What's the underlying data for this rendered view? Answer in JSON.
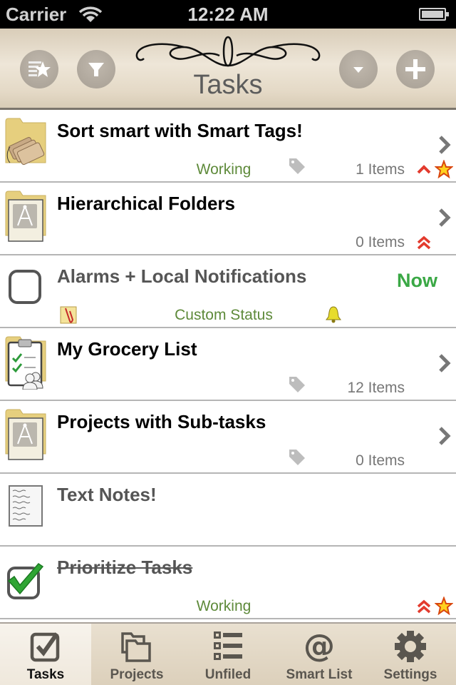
{
  "status_bar": {
    "carrier": "Carrier",
    "time": "12:22 AM",
    "wifi_icon": "wifi-icon",
    "battery_icon": "battery-full-icon"
  },
  "nav": {
    "title": "Tasks",
    "buttons": [
      {
        "name": "smart-tags-button",
        "icon": "list-star-icon"
      },
      {
        "name": "filter-button",
        "icon": "funnel-icon"
      },
      {
        "name": "sort-button",
        "icon": "chevron-down-icon"
      },
      {
        "name": "add-button",
        "icon": "plus-icon"
      }
    ]
  },
  "colors": {
    "status_green": "#5e8a3a",
    "now_green": "#3aa845",
    "priority_red": "#e33b2e",
    "star_yellow": "#ffd21f",
    "nav_bg": "#e4d9c6"
  },
  "rows": [
    {
      "title": "Sort smart with Smart Tags!",
      "icon": "folder-tags-icon",
      "status": "Working",
      "count": "1 Items",
      "tag": true,
      "priority": "high",
      "starred": true,
      "chevron": true
    },
    {
      "title": "Hierarchical Folders",
      "icon": "folder-project-icon",
      "status": "",
      "count": "0 Items",
      "tag": false,
      "priority": "highest",
      "starred": false,
      "chevron": true
    },
    {
      "title": "Alarms + Local Notifications",
      "icon": "checkbox-empty-icon",
      "status": "Custom Status",
      "due": "Now",
      "attachment": true,
      "alarm": true
    },
    {
      "title": "My Grocery List",
      "icon": "clipboard-shared-icon",
      "status": "",
      "count": "12 Items",
      "tag": true,
      "chevron": true
    },
    {
      "title": "Projects with Sub-tasks",
      "icon": "folder-project-icon",
      "status": "",
      "count": "0 Items",
      "tag": true,
      "chevron": true
    },
    {
      "title": "Text Notes!",
      "icon": "note-icon"
    },
    {
      "title": "Prioritize Tasks",
      "icon": "checkbox-checked-icon",
      "status": "Working",
      "completed": true,
      "priority": "highest",
      "starred": true
    }
  ],
  "tabs": [
    {
      "label": "Tasks",
      "icon": "checkbox-icon",
      "active": true
    },
    {
      "label": "Projects",
      "icon": "folders-icon",
      "active": false
    },
    {
      "label": "Unfiled",
      "icon": "list-icon",
      "active": false
    },
    {
      "label": "Smart List",
      "icon": "at-sign-icon",
      "active": false
    },
    {
      "label": "Settings",
      "icon": "gear-icon",
      "active": false
    }
  ]
}
